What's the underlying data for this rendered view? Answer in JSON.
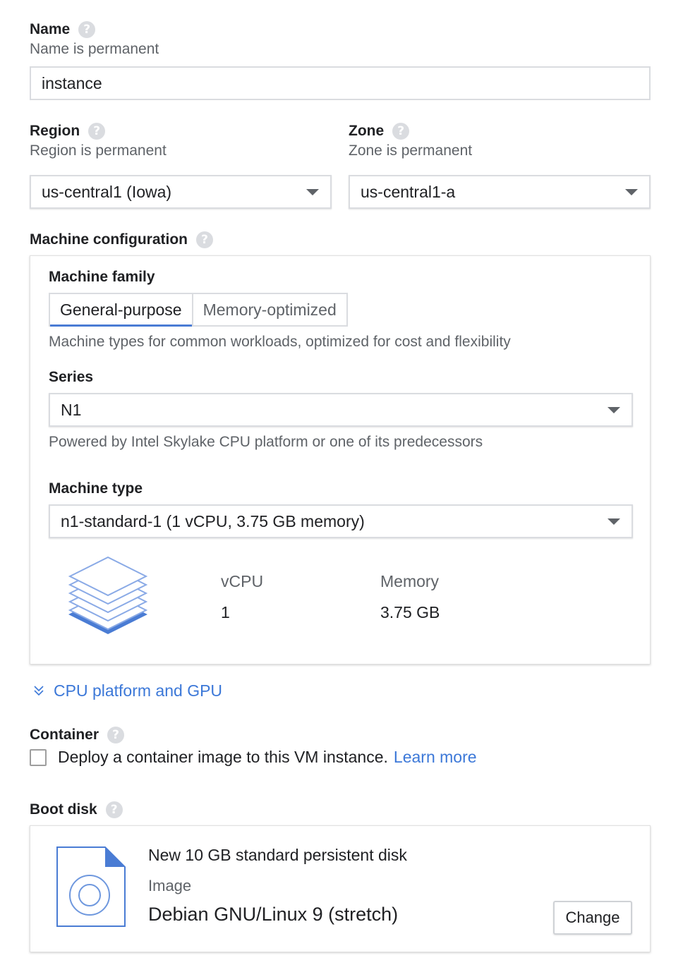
{
  "name": {
    "label": "Name",
    "hint": "Name is permanent",
    "value": "instance"
  },
  "region": {
    "label": "Region",
    "hint": "Region is permanent",
    "value": "us-central1 (Iowa)"
  },
  "zone": {
    "label": "Zone",
    "hint": "Zone is permanent",
    "value": "us-central1-a"
  },
  "machine_config": {
    "label": "Machine configuration",
    "family_label": "Machine family",
    "tabs": [
      "General-purpose",
      "Memory-optimized"
    ],
    "family_description": "Machine types for common workloads, optimized for cost and flexibility",
    "series_label": "Series",
    "series_value": "N1",
    "series_description": "Powered by Intel Skylake CPU platform or one of its predecessors",
    "type_label": "Machine type",
    "type_value": "n1-standard-1 (1 vCPU, 3.75 GB memory)",
    "vcpu_label": "vCPU",
    "vcpu_value": "1",
    "memory_label": "Memory",
    "memory_value": "3.75 GB"
  },
  "cpu_gpu_link": "CPU platform and GPU",
  "container": {
    "label": "Container",
    "checkbox_text": "Deploy a container image to this VM instance.",
    "learn_more": "Learn more"
  },
  "boot_disk": {
    "label": "Boot disk",
    "title": "New 10 GB standard persistent disk",
    "image_label": "Image",
    "image_value": "Debian GNU/Linux 9 (stretch)",
    "change_button": "Change"
  },
  "colors": {
    "accent": "#3c78d8",
    "stack_blue": "#4a7cd4"
  }
}
